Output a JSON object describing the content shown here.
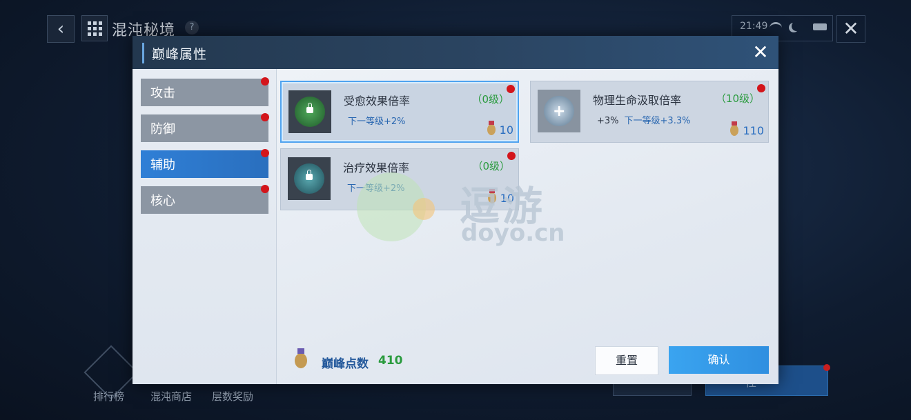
{
  "background": {
    "title": "混沌秘境",
    "help": "?",
    "time": "21:49",
    "bottom_nav": [
      "排行榜",
      "混沌商店",
      "层数奖励"
    ],
    "right_button": "性"
  },
  "modal": {
    "title": "巅峰属性",
    "close": "✕",
    "tabs": [
      {
        "label": "攻击",
        "active": false
      },
      {
        "label": "防御",
        "active": false
      },
      {
        "label": "辅助",
        "active": true
      },
      {
        "label": "核心",
        "active": false
      }
    ],
    "cards": [
      {
        "name": "受愈效果倍率",
        "level": "（0级）",
        "current": "",
        "next": "下一等级+2%",
        "cost": "10",
        "icon": "heal-receive-icon",
        "icon_color": "#2f7f3a",
        "selected": true
      },
      {
        "name": "物理生命汲取倍率",
        "level": "（10级）",
        "current": "+3%",
        "next": "下一等级+3.3%",
        "cost": "110",
        "icon": "life-steal-icon",
        "icon_color": "#6d8fa8",
        "selected": false
      },
      {
        "name": "治疗效果倍率",
        "level": "（0级）",
        "current": "",
        "next": "下一等级+2%",
        "cost": "10",
        "icon": "heal-effect-icon",
        "icon_color": "#2f6f80",
        "selected": false
      }
    ],
    "points_label": "巅峰点数",
    "points_value": "410",
    "reset_label": "重置",
    "confirm_label": "确认"
  },
  "watermark": {
    "cn": "逗游",
    "en": "doyo.cn"
  },
  "colors": {
    "accent": "#2f7fd6",
    "level_green": "#2a9b3e",
    "cost_blue": "#2a6ec0",
    "alert_red": "#d3151b"
  }
}
